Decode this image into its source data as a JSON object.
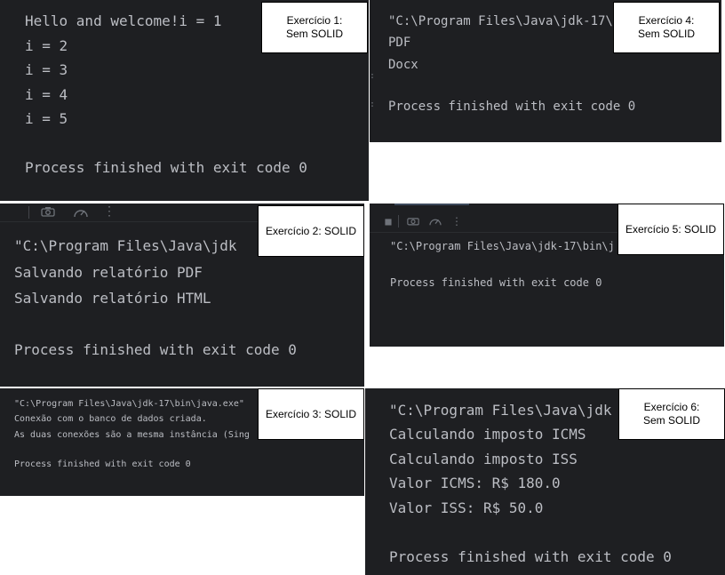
{
  "panels": {
    "ex1": {
      "label_line1": "Exercício 1:",
      "label_line2": "Sem SOLID",
      "lines": [
        "Hello and welcome!i = 1",
        "i = 2",
        "i = 3",
        "i = 4",
        "i = 5",
        "",
        "Process finished with exit code 0"
      ]
    },
    "ex4": {
      "label_line1": "Exercício 4:",
      "label_line2": "Sem SOLID",
      "lines": [
        "\"C:\\Program Files\\Java\\jdk-17\\",
        "PDF",
        "Docx",
        "",
        "Process finished with exit code 0"
      ]
    },
    "ex2": {
      "label_line1": "Exercício 2: SOLID",
      "lines": [
        "\"C:\\Program Files\\Java\\jdk",
        "Salvando relatório PDF",
        "Salvando relatório HTML",
        "",
        "Process finished with exit code 0"
      ]
    },
    "ex5": {
      "label_line1": "Exercício 5: SOLID",
      "lines": [
        "\"C:\\Program Files\\Java\\jdk-17\\bin\\j",
        "",
        "Process finished with exit code 0"
      ]
    },
    "ex3": {
      "label_line1": "Exercício 3: SOLID",
      "lines": [
        "\"C:\\Program Files\\Java\\jdk-17\\bin\\java.exe\"",
        "Conexão com o banco de dados criada.",
        "As duas conexões são a mesma instância (Sing",
        "",
        "Process finished with exit code 0"
      ]
    },
    "ex6": {
      "label_line1": "Exercício 6:",
      "label_line2": "Sem SOLID",
      "lines": [
        "\"C:\\Program Files\\Java\\jdk",
        "Calculando imposto ICMS",
        "Calculando imposto ISS",
        "Valor ICMS: R$ 180.0",
        "Valor ISS: R$ 50.0",
        "",
        "Process finished with exit code 0"
      ]
    }
  },
  "colors": {
    "console_bg": "#1e1f22",
    "console_text": "#bcbec4",
    "label_bg": "#ffffff",
    "label_border": "#000000"
  }
}
